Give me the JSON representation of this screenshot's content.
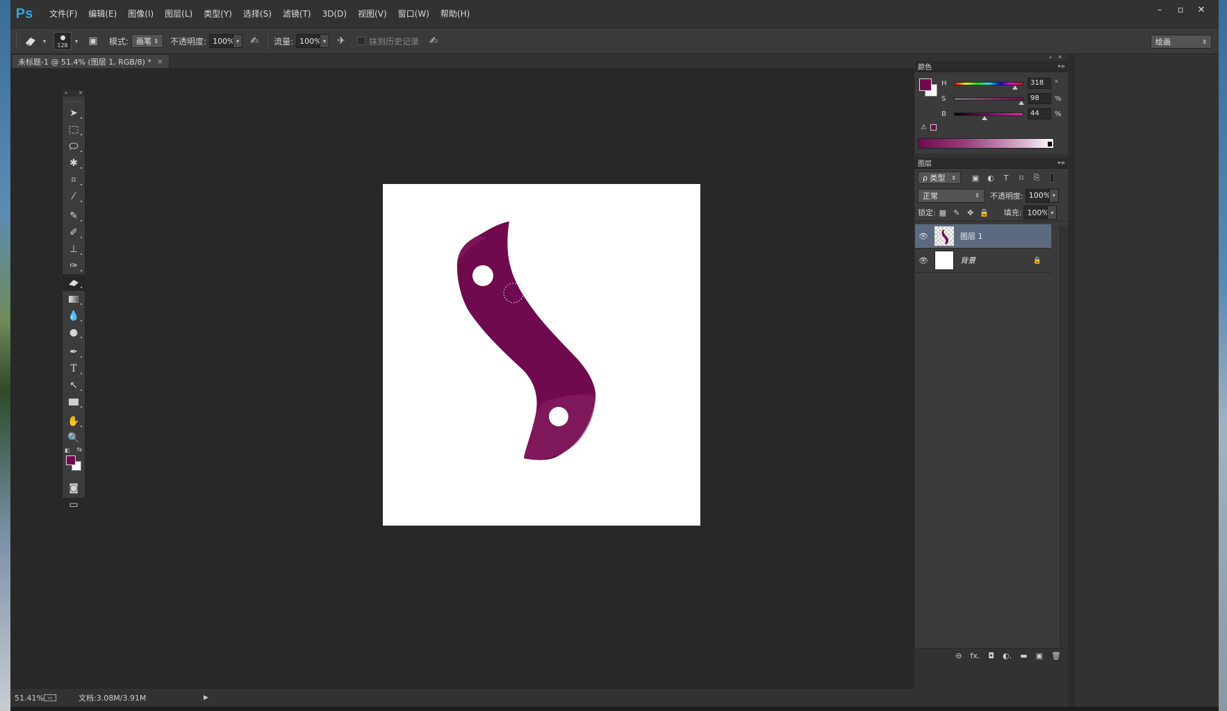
{
  "app": {
    "logo": "Ps",
    "menu": [
      "文件(F)",
      "编辑(E)",
      "图像(I)",
      "图层(L)",
      "类型(Y)",
      "选择(S)",
      "滤镜(T)",
      "3D(D)",
      "视图(V)",
      "窗口(W)",
      "帮助(H)"
    ],
    "window_controls": [
      "–",
      "▫",
      "✕"
    ]
  },
  "options": {
    "brush_size": "128",
    "mode_label": "模式:",
    "mode_value": "画笔",
    "opacity_label": "不透明度:",
    "opacity_value": "100%",
    "flow_label": "流量:",
    "flow_value": "100%",
    "erase_history_label": "抹到历史记录",
    "workspace": "绘画"
  },
  "document": {
    "tab_title": "未标题-1 @ 51.4% (图层 1, RGB/8) *",
    "close": "×"
  },
  "status": {
    "zoom": "51.41%",
    "doc_size": "文档:3.08M/3.91M"
  },
  "color_panel": {
    "title": "颜色",
    "foreground": "#6f0a4f",
    "background": "#ffffff",
    "h": {
      "label": "H",
      "value": "318",
      "unit": "°",
      "level": 0.883
    },
    "s": {
      "label": "S",
      "value": "98",
      "unit": "%",
      "level": 0.98
    },
    "b": {
      "label": "B",
      "value": "44",
      "unit": "%",
      "level": 0.44
    }
  },
  "layers_panel": {
    "title": "图层",
    "filter": "ρ 类型",
    "blend_mode": "正常",
    "opacity_label": "不透明度:",
    "opacity_value": "100%",
    "lock_label": "锁定:",
    "fill_label": "填充:",
    "fill_value": "100%",
    "layers": [
      {
        "name": "图层 1",
        "selected": true,
        "visible": true
      },
      {
        "name": "背景",
        "selected": false,
        "visible": true,
        "locked": true
      }
    ],
    "footer_icons": [
      "link-icon",
      "fx-icon",
      "mask-icon",
      "adjustment-icon",
      "folder-icon",
      "new-layer-icon",
      "trash-icon"
    ],
    "footer_labels": [
      "⊖",
      "fx.",
      "◘",
      "◐.",
      "▬",
      "▣",
      "🗑"
    ]
  },
  "toolbox": {
    "tools": [
      "move",
      "marquee",
      "lasso",
      "magic-wand",
      "crop",
      "eyedropper",
      "healing-brush",
      "brush",
      "clone-stamp",
      "history-brush",
      "eraser",
      "gradient",
      "blur",
      "dodge",
      "pen",
      "type",
      "path-selection",
      "rectangle",
      "hand",
      "zoom"
    ],
    "active_tool": "eraser"
  },
  "canvas": {
    "shape_color": "#6f0a4f"
  }
}
